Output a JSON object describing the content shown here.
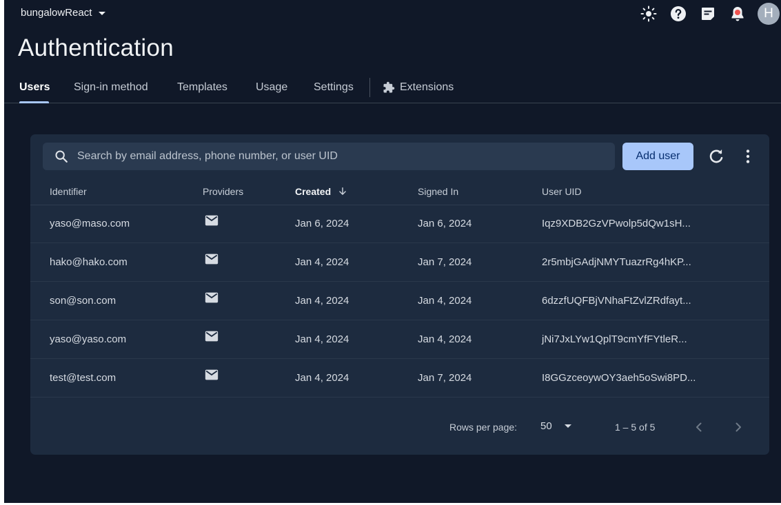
{
  "header": {
    "project_name": "bungalowReact",
    "icons": [
      "theme-icon",
      "help-icon",
      "notes-icon",
      "notifications-icon"
    ],
    "avatar_initial": "H"
  },
  "page": {
    "title": "Authentication"
  },
  "tabs": [
    {
      "label": "Users",
      "active": true
    },
    {
      "label": "Sign-in method"
    },
    {
      "label": "Templates"
    },
    {
      "label": "Usage"
    },
    {
      "label": "Settings"
    },
    {
      "label": "Extensions",
      "icon": "puzzle-icon"
    }
  ],
  "toolbar": {
    "search_placeholder": "Search by email address, phone number, or user UID",
    "add_user_label": "Add user"
  },
  "table": {
    "columns": [
      "Identifier",
      "Providers",
      "Created",
      "Signed In",
      "User UID"
    ],
    "sorted_column": "Created",
    "rows": [
      {
        "identifier": "yaso@maso.com",
        "provider": "email-icon",
        "created": "Jan 6, 2024",
        "signed_in": "Jan 6, 2024",
        "uid": "Iqz9XDB2GzVPwolp5dQw1sH..."
      },
      {
        "identifier": "hako@hako.com",
        "provider": "email-icon",
        "created": "Jan 4, 2024",
        "signed_in": "Jan 7, 2024",
        "uid": "2r5mbjGAdjNMYTuazrRg4hKP..."
      },
      {
        "identifier": "son@son.com",
        "provider": "email-icon",
        "created": "Jan 4, 2024",
        "signed_in": "Jan 4, 2024",
        "uid": "6dzzfUQFBjVNhaFtZvlZRdfayt..."
      },
      {
        "identifier": "yaso@yaso.com",
        "provider": "email-icon",
        "created": "Jan 4, 2024",
        "signed_in": "Jan 4, 2024",
        "uid": "jNi7JxLYw1QplT9cmYfFYtleR..."
      },
      {
        "identifier": "test@test.com",
        "provider": "email-icon",
        "created": "Jan 4, 2024",
        "signed_in": "Jan 7, 2024",
        "uid": "I8GGzceoywOY3aeh5oSwi8PD..."
      }
    ]
  },
  "pagination": {
    "rows_per_page_label": "Rows per page:",
    "rows_per_page": "50",
    "range": "1 – 5 of 5"
  },
  "colors": {
    "background": "#101828",
    "card": "#1d2b3f",
    "accent": "#a8c7fa",
    "notification_dot": "#ef5350"
  }
}
